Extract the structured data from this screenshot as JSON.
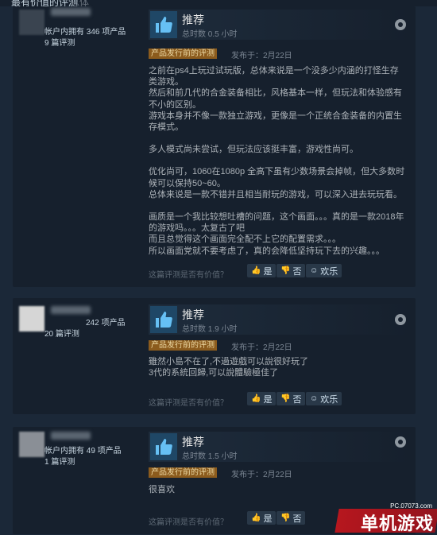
{
  "header": {
    "title": "最有价值的评测",
    "subtitle": "总体"
  },
  "common": {
    "recommend": "推荐",
    "badge": "产品发行前的评测",
    "helpful_question": "这篇评测是否有价值？",
    "yes": "是",
    "no": "否",
    "funny": "欢乐"
  },
  "reviews": [
    {
      "owned": "帐户内拥有 346 项产品",
      "review_count": "9 篇评测",
      "hours": "总时数 0.5 小时",
      "posted": "发布于：2月22日",
      "paragraphs": [
        "之前在ps4上玩过试玩版，总体来说是一个没多少内涵的打怪生存类游戏。",
        "然后和前几代的合金装备相比，风格基本一样，但玩法和体验感有不小的区别。",
        "游戏本身并不像一款独立游戏，更像是一个正统合金装备的内置生存模式。",
        "",
        "多人模式尚未尝试，但玩法应该挺丰富，游戏性尚可。",
        "",
        "优化尚可，1060在1080p 全高下虽有少数场景会掉帧，但大多数时候可以保持50~60。",
        "总体来说是一款不错并且相当耐玩的游戏，可以深入进去玩玩看。",
        "",
        "画质是一个我比较想吐槽的问题，这个画面。。。真的是一款2018年的游戏吗。。。太复古了吧",
        "而且总觉得这个画面完全配不上它的配置需求。。。",
        "所以画面党就不要考虑了，真的会降低坚持玩下去的兴趣。。。"
      ]
    },
    {
      "owned": "242 项产品",
      "review_count": "20 篇评测",
      "hours": "总时数 1.9 小时",
      "posted": "发布于：2月22日",
      "paragraphs": [
        "雖然小島不在了,不過遊戲可以說很好玩了",
        "3代的系統回歸,可以說體驗極佳了"
      ]
    },
    {
      "owned": "帐户内拥有 49 项产品",
      "review_count": "1 篇评测",
      "hours": "总时数 1.5 小时",
      "posted": "发布于：2月22日",
      "paragraphs": [
        "很喜欢"
      ]
    }
  ],
  "watermark": {
    "url": "PC.07073.com",
    "text": "单机游戏"
  }
}
